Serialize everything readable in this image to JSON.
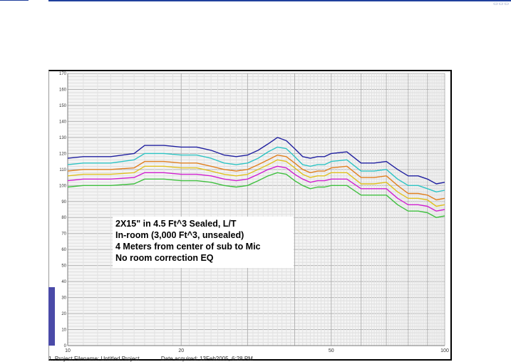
{
  "chart_data": {
    "type": "line",
    "x_scale": "log",
    "xlim": [
      10,
      100
    ],
    "ylim": [
      0,
      170
    ],
    "x_ticks": [
      10,
      20,
      50,
      100
    ],
    "y_ticks": [
      0,
      10,
      20,
      30,
      40,
      50,
      60,
      70,
      80,
      90,
      100,
      110,
      120,
      130,
      140,
      150,
      160,
      170
    ],
    "grid": true,
    "x": [
      10,
      11,
      12,
      13,
      15,
      16,
      17,
      18,
      20,
      22,
      24,
      26,
      28,
      30,
      32,
      34,
      36,
      38,
      40,
      42,
      44,
      46,
      48,
      50,
      55,
      60,
      65,
      70,
      75,
      80,
      85,
      90,
      95,
      100
    ],
    "series": [
      {
        "color": "#2020a0",
        "values": [
          117,
          118,
          118,
          118,
          120,
          125,
          125,
          125,
          124,
          124,
          122,
          119,
          118,
          119,
          122,
          126,
          130,
          128,
          123,
          118,
          117,
          118,
          118,
          120,
          121,
          114,
          114,
          115,
          110,
          106,
          106,
          104,
          101,
          102
        ]
      },
      {
        "color": "#2ec4c4",
        "values": [
          113,
          114,
          114,
          114,
          116,
          120,
          120,
          120,
          119,
          119,
          117,
          114,
          113,
          114,
          117,
          121,
          124,
          123,
          118,
          113,
          112,
          113,
          113,
          115,
          116,
          109,
          109,
          110,
          104,
          100,
          100,
          98,
          96,
          97
        ]
      },
      {
        "color": "#e08020",
        "values": [
          109,
          110,
          110,
          110,
          111,
          115,
          115,
          115,
          114,
          114,
          112,
          110,
          109,
          110,
          113,
          116,
          119,
          118,
          114,
          110,
          108,
          109,
          109,
          111,
          112,
          105,
          105,
          106,
          100,
          95,
          95,
          94,
          91,
          92
        ]
      },
      {
        "color": "#e0c020",
        "values": [
          106,
          107,
          107,
          107,
          108,
          112,
          112,
          112,
          111,
          111,
          109,
          107,
          106,
          107,
          110,
          113,
          116,
          115,
          111,
          107,
          105,
          106,
          106,
          108,
          108,
          101,
          101,
          102,
          96,
          92,
          92,
          91,
          87,
          88
        ]
      },
      {
        "color": "#d020d0",
        "values": [
          103,
          104,
          104,
          104,
          105,
          108,
          108,
          108,
          107,
          107,
          106,
          104,
          103,
          104,
          107,
          110,
          112,
          111,
          107,
          104,
          102,
          103,
          103,
          104,
          104,
          98,
          98,
          98,
          92,
          88,
          88,
          87,
          84,
          85
        ]
      },
      {
        "color": "#40c040",
        "values": [
          99,
          100,
          100,
          100,
          101,
          104,
          104,
          104,
          103,
          103,
          102,
          100,
          99,
          100,
          103,
          106,
          108,
          107,
          103,
          100,
          98,
          99,
          99,
          100,
          100,
          94,
          94,
          94,
          88,
          84,
          84,
          83,
          80,
          81
        ]
      }
    ],
    "annotations": [
      "2X15\" in 4.5 Ft^3   Sealed, L/T",
      "In-room (3,000 Ft^3, unsealed)",
      "4 Meters from center of sub to Mic",
      "No room correction EQ"
    ]
  },
  "footer": {
    "project": "1. Project Filename: Untitled Project",
    "acquired": "Date acquired: 13Feb2005, 6:28 PM"
  },
  "colors": {
    "frame": "#000000",
    "grid": "#c8c8c8",
    "accent": "#1f3f9c",
    "marker": "#4a4aa8"
  }
}
